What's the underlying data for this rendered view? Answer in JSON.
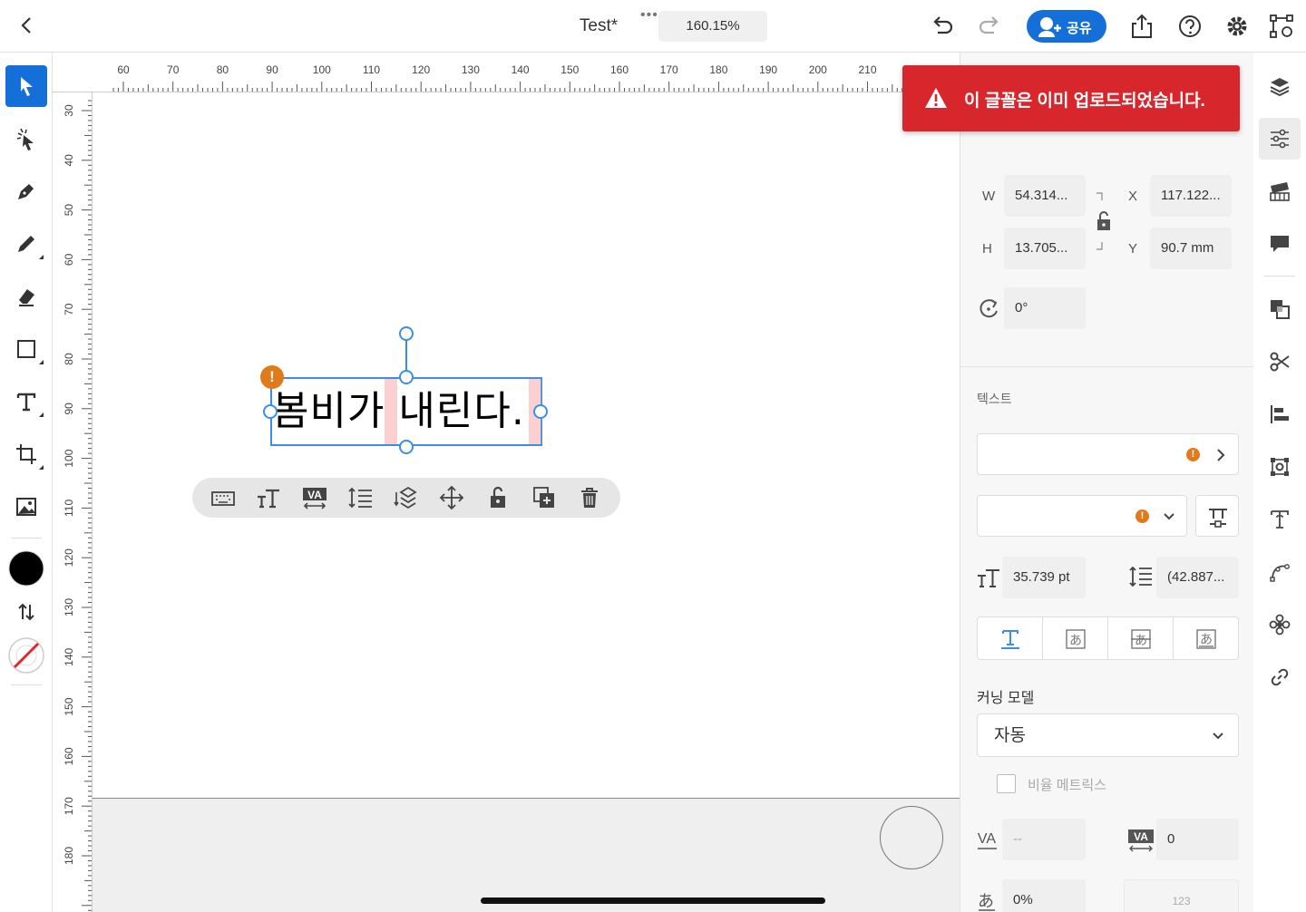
{
  "topbar": {
    "title": "Test*",
    "zoom": "160.15%",
    "share_label": "공유",
    "more_dots": "•••"
  },
  "toast": {
    "message": "이 글꼴은 이미 업로드되었습니다.",
    "color": "#d7262c"
  },
  "ruler": {
    "horizontal": [
      "60",
      "70",
      "80",
      "90",
      "100",
      "110",
      "120",
      "130",
      "140",
      "150",
      "160",
      "170",
      "180",
      "190",
      "200",
      "210"
    ],
    "vertical": [
      "30",
      "40",
      "50",
      "60",
      "70",
      "80",
      "90",
      "100",
      "110",
      "120",
      "130",
      "140",
      "150",
      "160",
      "170",
      "180"
    ]
  },
  "canvas": {
    "selected_text": "봄비가 내린다."
  },
  "transform": {
    "w_label": "W",
    "w_value": "54.314...",
    "h_label": "H",
    "h_value": "13.705...",
    "x_label": "X",
    "x_value": "117.122...",
    "y_label": "Y",
    "y_value": "90.7 mm",
    "rotation_value": "0°"
  },
  "text_section": {
    "title": "텍스트",
    "font_size": "35.739 pt",
    "leading": "(42.887...",
    "kerning_label": "커닝 모델",
    "kerning_value": "자동",
    "proportional_metrics_label": "비율 메트릭스",
    "kerning_field_value": "--",
    "tracking_value": "0",
    "tsume_value": "0%",
    "numeral_glyph": "123"
  },
  "colors": {
    "accent": "#1470d8",
    "warning": "#e07a1a",
    "selection": "#3a8ee6",
    "fill": "#000000"
  }
}
